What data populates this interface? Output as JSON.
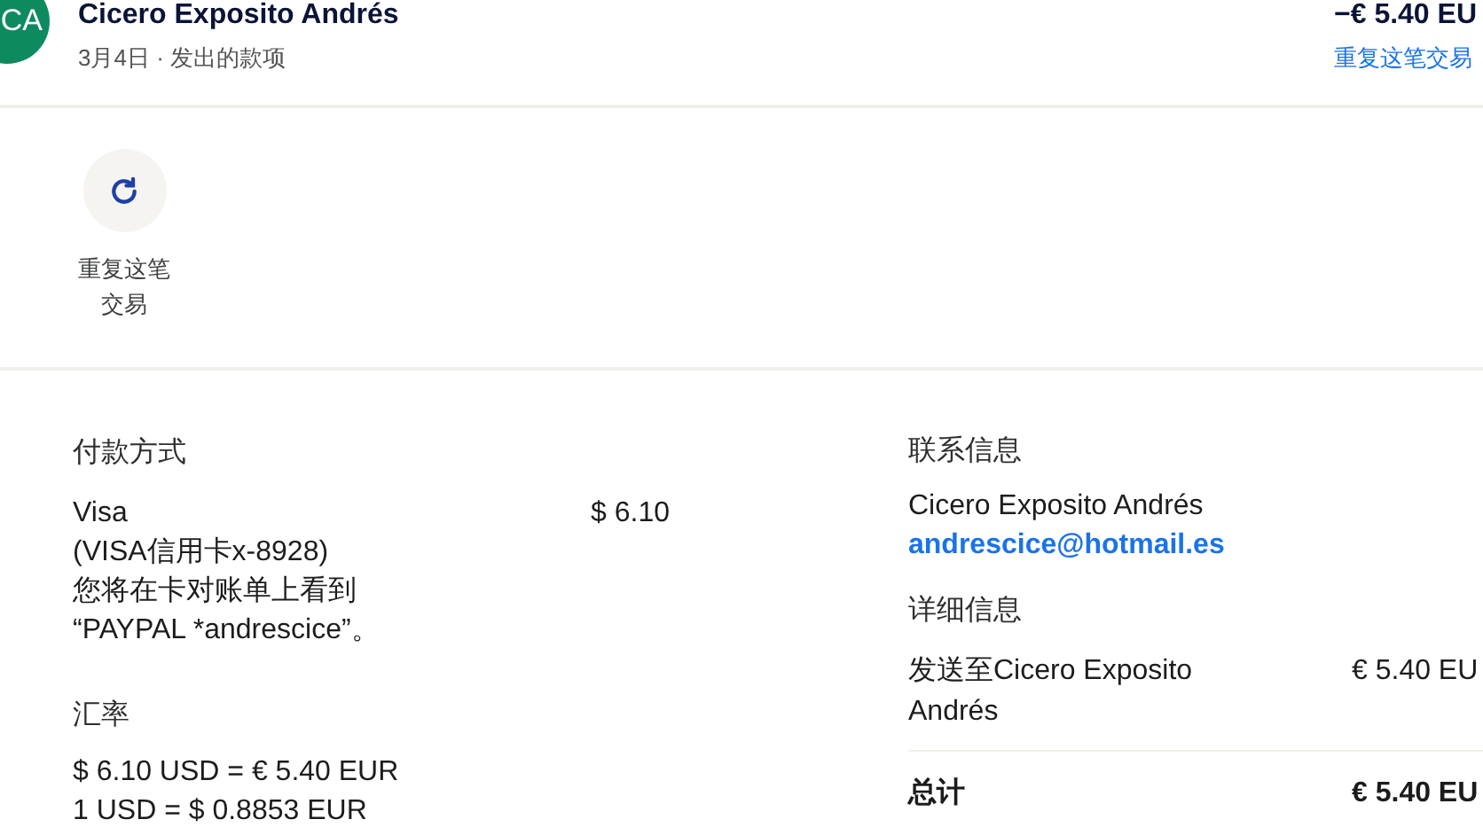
{
  "header": {
    "avatar": "CA",
    "name": "Cicero Exposito Andrés",
    "subtitle": "3月4日 · 发出的款项",
    "amount": "−€ 5.40 EU",
    "repeat_link": "重复这笔交易"
  },
  "actions": [
    {
      "label": "重复这笔交易"
    }
  ],
  "payment": {
    "title": "付款方式",
    "method_lines": [
      "Visa",
      "(VISA信用卡x-8928)",
      "您将在卡对账单上看到",
      "“PAYPAL *andrescice”。"
    ],
    "amount": "$ 6.10"
  },
  "exchange": {
    "title": "汇率",
    "lines": [
      "$ 6.10 USD = € 5.40 EUR",
      "1 USD = $ 0.8853 EUR"
    ]
  },
  "contact": {
    "title": "联系信息",
    "name": "Cicero Exposito Andrés",
    "email": "andrescice@hotmail.es"
  },
  "details": {
    "title": "详细信息",
    "rows": [
      {
        "label": "发送至Cicero Exposito Andrés",
        "amount": "€ 5.40 EU"
      }
    ],
    "total_label": "总计",
    "total_amount": "€ 5.40 EU"
  }
}
